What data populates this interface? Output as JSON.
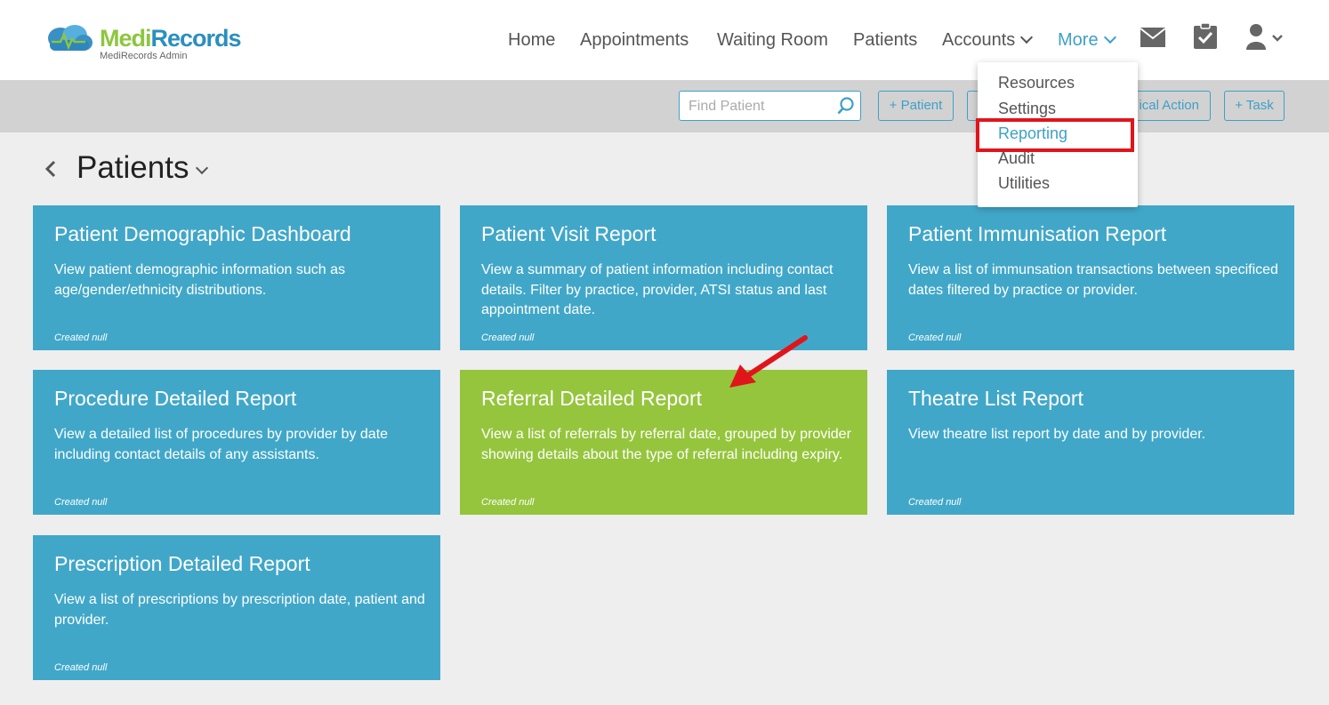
{
  "brand": {
    "name_part1": "Medi",
    "name_part2": "Records",
    "subtitle": "MediRecords Admin"
  },
  "nav": {
    "items": [
      {
        "label": "Home"
      },
      {
        "label": "Appointments"
      },
      {
        "label": "Waiting Room"
      },
      {
        "label": "Patients"
      },
      {
        "label": "Accounts"
      },
      {
        "label": "More"
      }
    ],
    "icons": [
      "mail-icon",
      "clipboard-check-icon",
      "user-icon"
    ]
  },
  "dropdown": {
    "items": [
      {
        "label": "Resources"
      },
      {
        "label": "Settings"
      },
      {
        "label": "Reporting"
      },
      {
        "label": "Audit"
      },
      {
        "label": "Utilities"
      }
    ],
    "highlighted": "Reporting"
  },
  "toolbar": {
    "search_placeholder": "Find Patient",
    "buttons": [
      {
        "label": "+ Patient"
      },
      {
        "label": ""
      },
      {
        "label": "ical Action"
      },
      {
        "label": "+ Task"
      }
    ]
  },
  "page": {
    "title": "Patients"
  },
  "cards": [
    {
      "title": "Patient Demographic Dashboard",
      "description": "View patient demographic information such as age/gender/ethnicity distributions.",
      "created": "Created null"
    },
    {
      "title": "Patient Visit Report",
      "description": "View a summary of patient information including contact details. Filter by practice, provider, ATSI status and last appointment date.",
      "created": "Created null"
    },
    {
      "title": "Patient Immunisation Report",
      "description": "View a list of immunsation transactions between specificed dates filtered by practice or provider.",
      "created": "Created null"
    },
    {
      "title": "Procedure Detailed Report",
      "description": "View a detailed list of procedures by provider by date including contact details of any assistants.",
      "created": "Created null"
    },
    {
      "title": "Referral Detailed Report",
      "description": "View a list of referrals by referral date, grouped by provider showing details about the type of referral including expiry.",
      "created": "Created null"
    },
    {
      "title": "Theatre List Report",
      "description": "View theatre list report by date and by provider.",
      "created": "Created null"
    },
    {
      "title": "Prescription Detailed Report",
      "description": "View a list of prescriptions by prescription date, patient and provider.",
      "created": "Created null"
    }
  ],
  "colors": {
    "card_blue": "#41a7c9",
    "card_green": "#95c53d",
    "accent": "#3fa0c8",
    "annotation_red": "#e0151b"
  }
}
